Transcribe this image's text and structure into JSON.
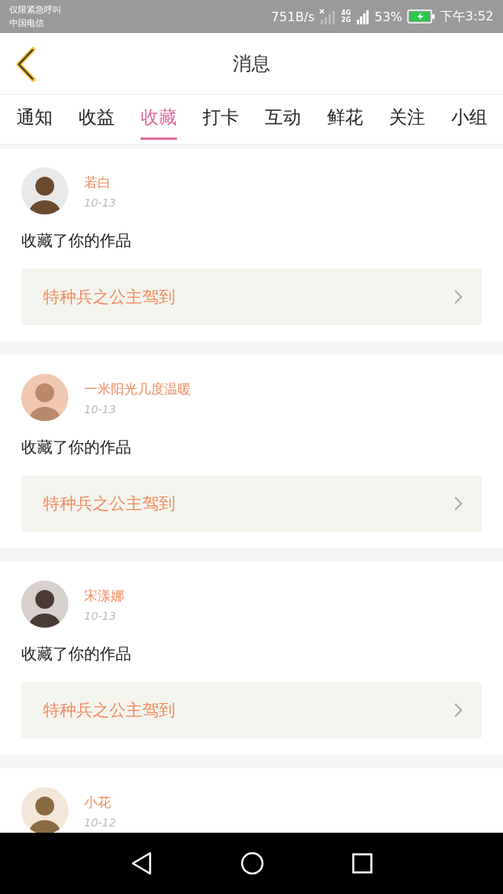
{
  "status_bar": {
    "emergency": "仅限紧急呼叫",
    "carrier": "中国电信",
    "speed": "751B/s",
    "network": "4G",
    "network_2": "2G",
    "battery": "53%",
    "time": "下午3:52"
  },
  "header": {
    "title": "消息"
  },
  "tabs": [
    {
      "label": "通知",
      "selected": false
    },
    {
      "label": "收益",
      "selected": false
    },
    {
      "label": "收藏",
      "selected": true
    },
    {
      "label": "打卡",
      "selected": false
    },
    {
      "label": "互动",
      "selected": false
    },
    {
      "label": "鲜花",
      "selected": false
    },
    {
      "label": "关注",
      "selected": false
    },
    {
      "label": "小组",
      "selected": false
    }
  ],
  "messages": [
    {
      "user": "若白",
      "date": "10-13",
      "text": "收藏了你的作品",
      "work": "特种兵之公主驾到"
    },
    {
      "user": "一米阳光几度温暖",
      "date": "10-13",
      "text": "收藏了你的作品",
      "work": "特种兵之公主驾到"
    },
    {
      "user": "宋漾娜",
      "date": "10-13",
      "text": "收藏了你的作品",
      "work": "特种兵之公主驾到"
    },
    {
      "user": "小花",
      "date": "10-12"
    }
  ]
}
